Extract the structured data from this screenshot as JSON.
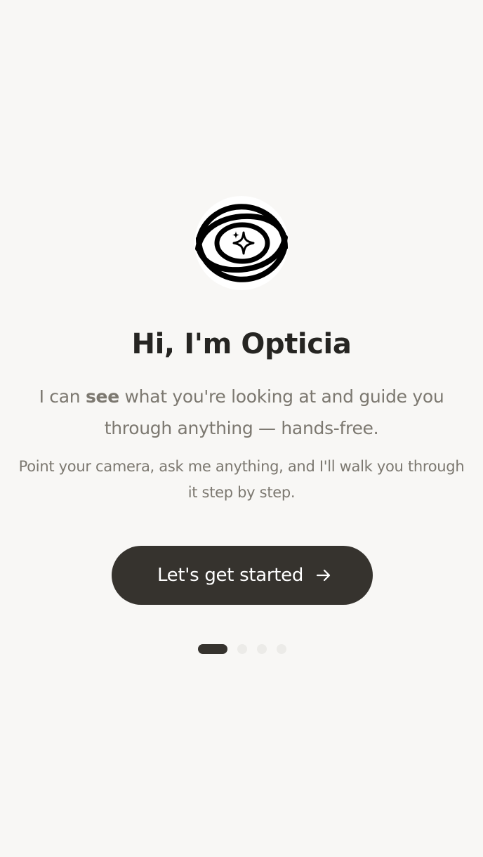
{
  "welcome": {
    "title": "Hi, I'm Opticia",
    "lead_prefix": "I can ",
    "lead_emphasis": "see",
    "lead_suffix": " what you're looking at and guide you through anything — hands-free.",
    "sub": "Point your camera, ask me anything, and I'll walk you through it step by step.",
    "cta_label": "Let's get started",
    "cta_icon": "arrow-right-icon",
    "logo_icon": "eye-sparkle-icon"
  },
  "pager": {
    "total_pages": 4,
    "current_page": 1
  },
  "colors": {
    "background": "#f8f7f5",
    "title": "#262522",
    "body_text": "#7c7870",
    "button": "#36332e",
    "button_text": "#ffffff",
    "dot_inactive": "#ecebe8"
  }
}
